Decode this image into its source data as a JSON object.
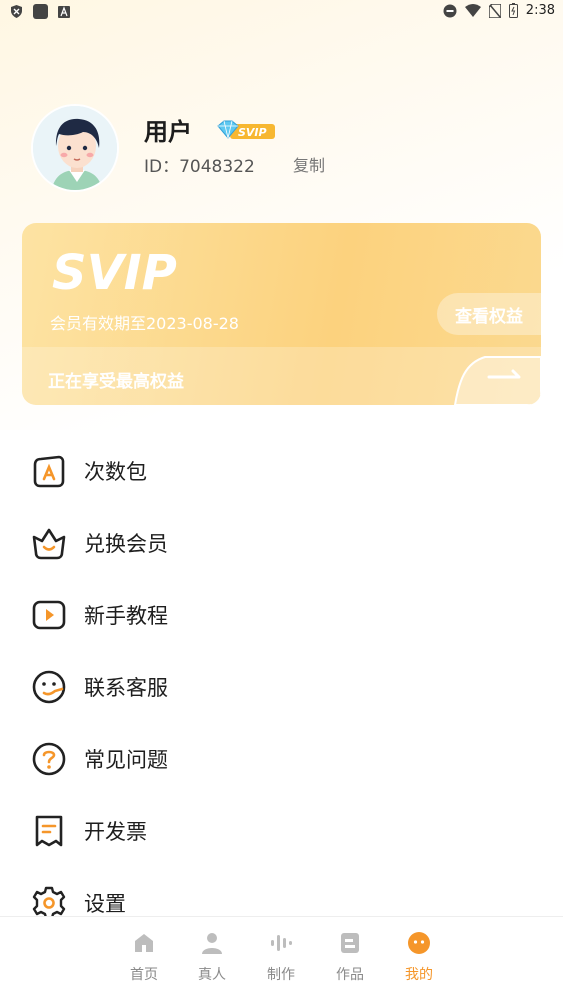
{
  "status_bar": {
    "time": "2:38"
  },
  "profile": {
    "username": "用户",
    "badge": "SVIP",
    "id_text": "ID：7048322",
    "copy_label": "复制"
  },
  "vip_card": {
    "logo_text": "SVIP",
    "expiry": "会员有效期至2023-08-28",
    "benefits_button": "查看权益",
    "status_text": "正在享受最高权益"
  },
  "menu": {
    "items": [
      {
        "label": "次数包",
        "icon": "package-icon"
      },
      {
        "label": "兑换会员",
        "icon": "crown-icon"
      },
      {
        "label": "新手教程",
        "icon": "play-icon"
      },
      {
        "label": "联系客服",
        "icon": "service-icon"
      },
      {
        "label": "常见问题",
        "icon": "question-icon"
      },
      {
        "label": "开发票",
        "icon": "invoice-icon"
      },
      {
        "label": "设置",
        "icon": "gear-icon"
      }
    ]
  },
  "bottom_nav": {
    "items": [
      {
        "label": "首页",
        "icon": "home-icon"
      },
      {
        "label": "真人",
        "icon": "person-icon"
      },
      {
        "label": "制作",
        "icon": "waveform-icon"
      },
      {
        "label": "作品",
        "icon": "works-icon"
      },
      {
        "label": "我的",
        "icon": "profile-icon",
        "active": true
      }
    ]
  },
  "colors": {
    "accent": "#f5962a",
    "vip_gold": "#fcd27e"
  }
}
